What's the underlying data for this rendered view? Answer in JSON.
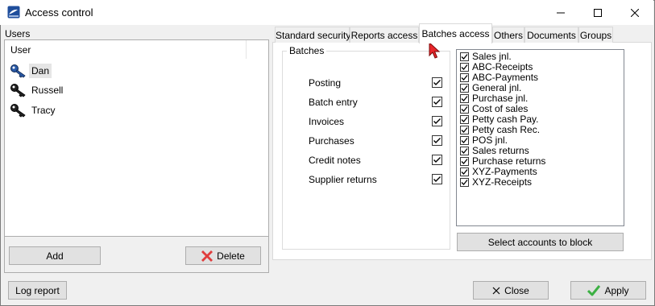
{
  "window": {
    "title": "Access control"
  },
  "users": {
    "section_label": "Users",
    "column_header": "User",
    "items": [
      {
        "name": "Dan",
        "icon": "key-icon-blue",
        "selected": true
      },
      {
        "name": "Russell",
        "icon": "key-icon",
        "selected": false
      },
      {
        "name": "Tracy",
        "icon": "key-icon",
        "selected": false
      }
    ],
    "add_label": "Add",
    "delete_label": "Delete"
  },
  "tabs": [
    {
      "label": "Standard security",
      "active": false
    },
    {
      "label": "Reports access",
      "active": false
    },
    {
      "label": "Batches access",
      "active": true
    },
    {
      "label": "Others",
      "active": false
    },
    {
      "label": "Documents",
      "active": false
    },
    {
      "label": "Groups",
      "active": false
    }
  ],
  "batches": {
    "group_title": "Batches",
    "options": [
      {
        "label": "Posting",
        "checked": true
      },
      {
        "label": "Batch entry",
        "checked": true
      },
      {
        "label": "Invoices",
        "checked": true
      },
      {
        "label": "Purchases",
        "checked": true
      },
      {
        "label": "Credit notes",
        "checked": true
      },
      {
        "label": "Supplier returns",
        "checked": true
      }
    ]
  },
  "accounts": {
    "items": [
      {
        "label": "Sales jnl.",
        "checked": true
      },
      {
        "label": "ABC-Receipts",
        "checked": true
      },
      {
        "label": "ABC-Payments",
        "checked": true
      },
      {
        "label": "General jnl.",
        "checked": true
      },
      {
        "label": "Purchase jnl.",
        "checked": true
      },
      {
        "label": "Cost of sales",
        "checked": true
      },
      {
        "label": "Petty cash Pay.",
        "checked": true
      },
      {
        "label": "Petty cash Rec.",
        "checked": true
      },
      {
        "label": "POS jnl.",
        "checked": true
      },
      {
        "label": "Sales returns",
        "checked": true
      },
      {
        "label": "Purchase returns",
        "checked": true
      },
      {
        "label": "XYZ-Payments",
        "checked": true
      },
      {
        "label": "XYZ-Receipts",
        "checked": true
      }
    ],
    "block_button_label": "Select accounts to block"
  },
  "footer": {
    "log_report_label": "Log report",
    "close_label": "Close",
    "apply_label": "Apply"
  },
  "colors": {
    "delete_icon": "#e03c3c",
    "apply_icon": "#3cb043",
    "cursor": "#e8262b"
  }
}
